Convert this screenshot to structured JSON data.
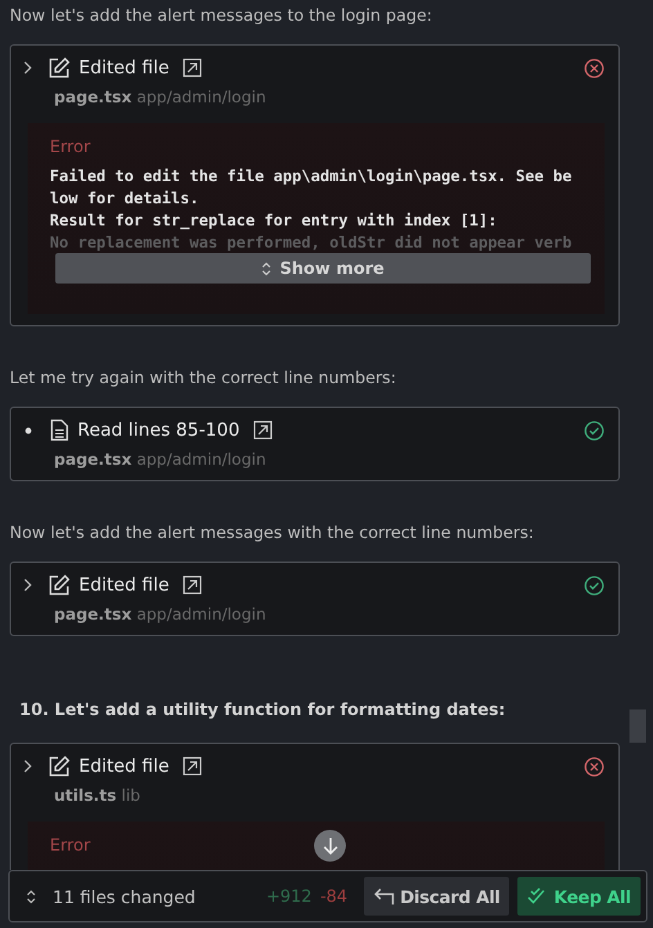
{
  "blocks": [
    {
      "kind": "text",
      "text": "Now let's add the alert messages to the login page:"
    },
    {
      "kind": "edit",
      "title": "Edited file",
      "failed": true,
      "file": "page.tsx",
      "dir": "app/admin/login",
      "error": {
        "label": "Error",
        "lines": [
          "Failed to edit the file app\\admin\\login\\page.tsx. See be",
          "low for details.",
          "Result for str_replace for entry with index [1]:"
        ],
        "faded_lines": [
          "No replacement was performed, oldStr did not appear verb"
        ],
        "show_more": "Show more"
      }
    },
    {
      "kind": "text",
      "text": "Let me try again with the correct line numbers:"
    },
    {
      "kind": "read",
      "title": "Read lines 85-100",
      "failed": false,
      "file": "page.tsx",
      "dir": "app/admin/login"
    },
    {
      "kind": "text",
      "text": "Now let's add the alert messages with the correct line numbers:"
    },
    {
      "kind": "edit",
      "title": "Edited file",
      "failed": false,
      "file": "page.tsx",
      "dir": "app/admin/login"
    },
    {
      "kind": "heading",
      "text": "10. Let's add a utility function for formatting dates:"
    },
    {
      "kind": "edit",
      "title": "Edited file",
      "failed": true,
      "file": "utils.ts",
      "dir": "lib",
      "error": {
        "label": "Error"
      }
    }
  ],
  "footer": {
    "files_changed": "11 files changed",
    "added": "+912",
    "removed": "-84",
    "buttons": [
      {
        "kind": "discard",
        "label": "Discard All"
      },
      {
        "kind": "keep",
        "label": "Keep All"
      }
    ]
  }
}
